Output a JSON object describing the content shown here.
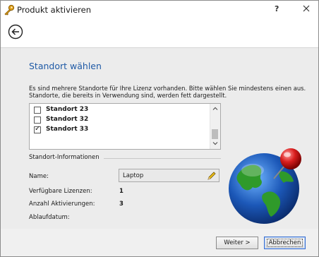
{
  "window": {
    "title": "Produkt aktivieren",
    "help_label": "?"
  },
  "page": {
    "heading": "Standort wählen",
    "description": "Es sind mehrere Standorte für Ihre Lizenz vorhanden. Bitte wählen Sie mindestens einen aus. Standorte, die bereits in Verwendung sind, werden fett dargestellt."
  },
  "locations": [
    {
      "label": "Standort 23",
      "checked": false
    },
    {
      "label": "Standort 32",
      "checked": false
    },
    {
      "label": "Standort 33",
      "checked": true
    }
  ],
  "info": {
    "section_title": "Standort-Informationen",
    "name_label": "Name:",
    "name_value": "Laptop",
    "licenses_label": "Verfügbare Lizenzen:",
    "licenses_value": "1",
    "activations_label": "Anzahl Aktivierungen:",
    "activations_value": "3",
    "expiry_label": "Ablaufdatum:",
    "expiry_value": ""
  },
  "footer": {
    "next_label": "Weiter >",
    "cancel_label": "Abbrechen"
  },
  "colors": {
    "heading": "#1f5aa6",
    "globe_ocean": "#1c58b8",
    "globe_land": "#2f9a2a",
    "pin": "#d91e1e"
  }
}
